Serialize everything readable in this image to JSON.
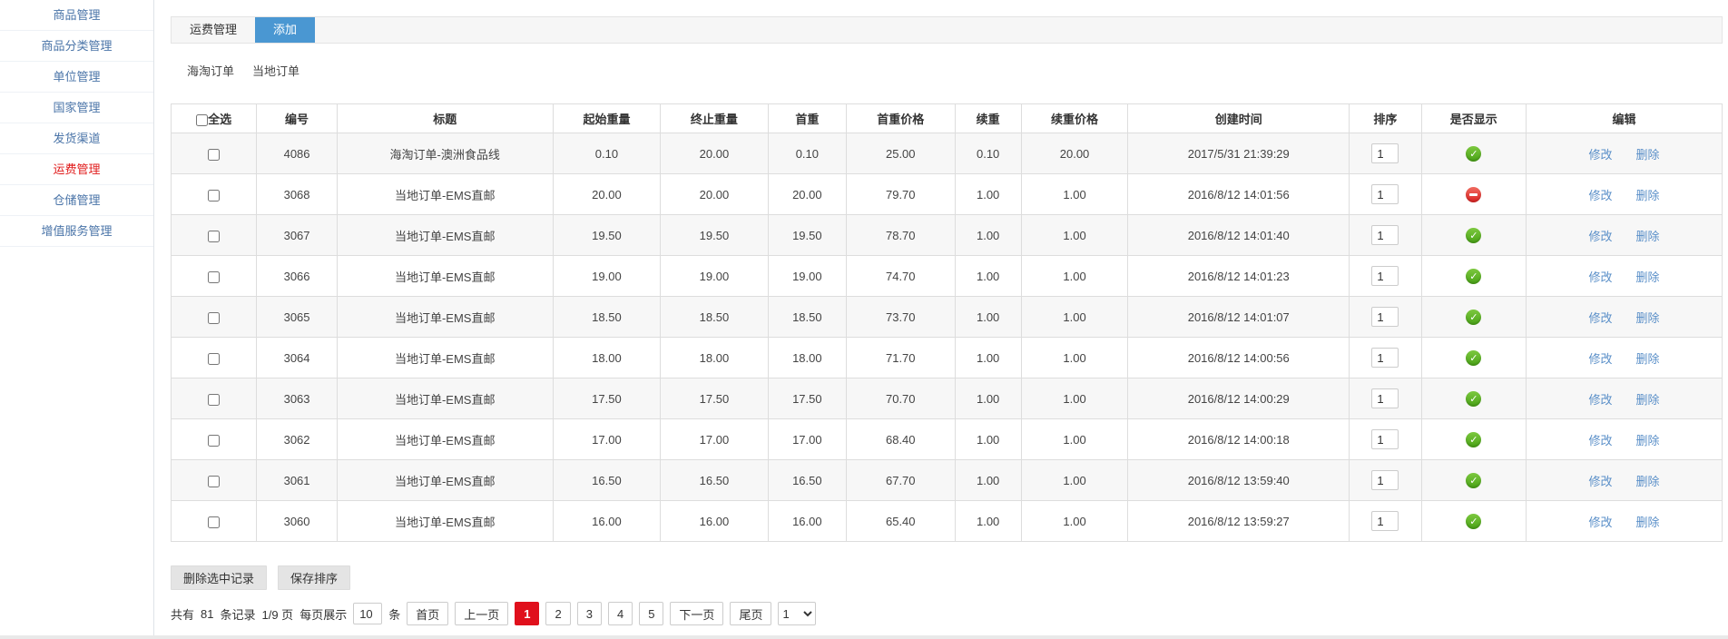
{
  "colors": {
    "accent_blue": "#4a97d2",
    "sidebar_link": "#4a74a8",
    "active_menu_red": "#e01b1b",
    "edit_link_blue": "#5a8fc8",
    "active_page_red": "#e0101c",
    "status_green": "#49a316",
    "status_red": "#dc2323"
  },
  "sidebar": {
    "items": [
      {
        "label": "商品管理",
        "active": false
      },
      {
        "label": "商品分类管理",
        "active": false
      },
      {
        "label": "单位管理",
        "active": false
      },
      {
        "label": "国家管理",
        "active": false
      },
      {
        "label": "发货渠道",
        "active": false
      },
      {
        "label": "运费管理",
        "active": true
      },
      {
        "label": "仓储管理",
        "active": false
      },
      {
        "label": "增值服务管理",
        "active": false
      }
    ]
  },
  "tabs": {
    "items": [
      {
        "label": "运费管理",
        "active": false
      },
      {
        "label": "添加",
        "active": true
      }
    ]
  },
  "subnav": {
    "links": [
      "海淘订单",
      "当地订单"
    ]
  },
  "table": {
    "select_all_label": "全选",
    "columns": [
      "编号",
      "标题",
      "起始重量",
      "终止重量",
      "首重",
      "首重价格",
      "续重",
      "续重价格",
      "创建时间",
      "排序",
      "是否显示",
      "编辑"
    ],
    "edit_labels": {
      "modify": "修改",
      "delete": "删除"
    },
    "rows": [
      {
        "id": "4086",
        "title": "海淘订单-澳洲食品线",
        "start_weight": "0.10",
        "end_weight": "20.00",
        "first_weight": "0.10",
        "first_price": "25.00",
        "cont_weight": "0.10",
        "cont_price": "20.00",
        "created": "2017/5/31 21:39:29",
        "sort": "1",
        "visible": true
      },
      {
        "id": "3068",
        "title": "当地订单-EMS直邮",
        "start_weight": "20.00",
        "end_weight": "20.00",
        "first_weight": "20.00",
        "first_price": "79.70",
        "cont_weight": "1.00",
        "cont_price": "1.00",
        "created": "2016/8/12 14:01:56",
        "sort": "1",
        "visible": false
      },
      {
        "id": "3067",
        "title": "当地订单-EMS直邮",
        "start_weight": "19.50",
        "end_weight": "19.50",
        "first_weight": "19.50",
        "first_price": "78.70",
        "cont_weight": "1.00",
        "cont_price": "1.00",
        "created": "2016/8/12 14:01:40",
        "sort": "1",
        "visible": true
      },
      {
        "id": "3066",
        "title": "当地订单-EMS直邮",
        "start_weight": "19.00",
        "end_weight": "19.00",
        "first_weight": "19.00",
        "first_price": "74.70",
        "cont_weight": "1.00",
        "cont_price": "1.00",
        "created": "2016/8/12 14:01:23",
        "sort": "1",
        "visible": true
      },
      {
        "id": "3065",
        "title": "当地订单-EMS直邮",
        "start_weight": "18.50",
        "end_weight": "18.50",
        "first_weight": "18.50",
        "first_price": "73.70",
        "cont_weight": "1.00",
        "cont_price": "1.00",
        "created": "2016/8/12 14:01:07",
        "sort": "1",
        "visible": true
      },
      {
        "id": "3064",
        "title": "当地订单-EMS直邮",
        "start_weight": "18.00",
        "end_weight": "18.00",
        "first_weight": "18.00",
        "first_price": "71.70",
        "cont_weight": "1.00",
        "cont_price": "1.00",
        "created": "2016/8/12 14:00:56",
        "sort": "1",
        "visible": true
      },
      {
        "id": "3063",
        "title": "当地订单-EMS直邮",
        "start_weight": "17.50",
        "end_weight": "17.50",
        "first_weight": "17.50",
        "first_price": "70.70",
        "cont_weight": "1.00",
        "cont_price": "1.00",
        "created": "2016/8/12 14:00:29",
        "sort": "1",
        "visible": true
      },
      {
        "id": "3062",
        "title": "当地订单-EMS直邮",
        "start_weight": "17.00",
        "end_weight": "17.00",
        "first_weight": "17.00",
        "first_price": "68.40",
        "cont_weight": "1.00",
        "cont_price": "1.00",
        "created": "2016/8/12 14:00:18",
        "sort": "1",
        "visible": true
      },
      {
        "id": "3061",
        "title": "当地订单-EMS直邮",
        "start_weight": "16.50",
        "end_weight": "16.50",
        "first_weight": "16.50",
        "first_price": "67.70",
        "cont_weight": "1.00",
        "cont_price": "1.00",
        "created": "2016/8/12 13:59:40",
        "sort": "1",
        "visible": true
      },
      {
        "id": "3060",
        "title": "当地订单-EMS直邮",
        "start_weight": "16.00",
        "end_weight": "16.00",
        "first_weight": "16.00",
        "first_price": "65.40",
        "cont_weight": "1.00",
        "cont_price": "1.00",
        "created": "2016/8/12 13:59:27",
        "sort": "1",
        "visible": true
      }
    ]
  },
  "actions": {
    "delete_selected": "删除选中记录",
    "save_sort": "保存排序"
  },
  "pagination": {
    "total_prefix": "共有",
    "total_count": "81",
    "total_suffix": "条记录",
    "page_info": "1/9 页",
    "per_page_label": "每页展示",
    "per_page_value": "10",
    "per_page_unit": "条",
    "first_label": "首页",
    "prev_label": "上一页",
    "pages": [
      "1",
      "2",
      "3",
      "4",
      "5"
    ],
    "active_page": "1",
    "next_label": "下一页",
    "last_label": "尾页",
    "jump_value": "1"
  }
}
